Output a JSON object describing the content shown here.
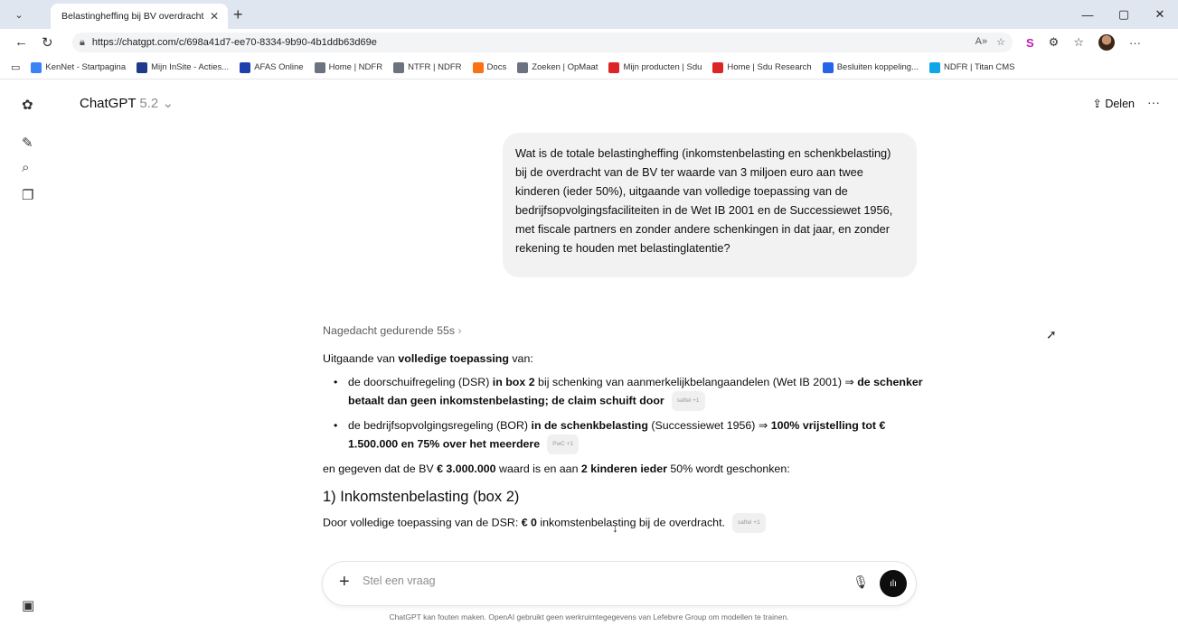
{
  "browser": {
    "tab_title": "Belastingheffing bij BV overdracht",
    "url": "https://chatgpt.com/c/698a41d7-ee70-8334-9b90-4b1ddb63d69e",
    "bookmarks": [
      {
        "label": "KenNet - Startpagina",
        "color": "#3b82f6"
      },
      {
        "label": "Mijn InSite - Acties...",
        "color": "#1e3a8a"
      },
      {
        "label": "AFAS Online",
        "color": "#1e40af"
      },
      {
        "label": "Home | NDFR",
        "color": "#6b7280"
      },
      {
        "label": "NTFR | NDFR",
        "color": "#6b7280"
      },
      {
        "label": "Docs",
        "color": "#f97316"
      },
      {
        "label": "Zoeken | OpMaat",
        "color": "#6b7280"
      },
      {
        "label": "Mijn producten | Sdu",
        "color": "#dc2626"
      },
      {
        "label": "Home | Sdu Research",
        "color": "#dc2626"
      },
      {
        "label": "Besluiten koppeling...",
        "color": "#2563eb"
      },
      {
        "label": "NDFR | Titan CMS",
        "color": "#0ea5e9"
      }
    ]
  },
  "app": {
    "model_name": "ChatGPT",
    "model_version": "5.2",
    "share_label": "Delen"
  },
  "conversation": {
    "user_message": "Wat is de totale belastingheffing (inkomstenbelasting en schenkbelasting) bij de overdracht van de BV ter waarde van 3 miljoen euro aan twee kinderen (ieder 50%), uitgaande van volledige toepassing van de bedrijfsopvolgingsfaciliteiten in de Wet IB 2001 en de Successiewet 1956, met fiscale partners en zonder andere schenkingen in dat jaar, en zonder rekening te houden met belastinglatentie?",
    "thought_label": "Nagedacht gedurende 55s",
    "intro_prefix": "Uitgaande van ",
    "intro_bold": "volledige toepassing",
    "intro_suffix": " van:",
    "bullet1": {
      "t1": "de doorschuifregeling (DSR) ",
      "b1": "in box 2",
      "t2": " bij schenking van aanmerkelijkbelangaandelen (Wet IB 2001) ⇒ ",
      "b2": "de schenker betaalt dan geen inkomstenbelasting; de claim schuift door",
      "badge": "saftel +1"
    },
    "bullet2": {
      "t1": "de bedrijfsopvolgingsregeling (BOR) ",
      "b1": "in de schenkbelasting",
      "t2": " (Successiewet 1956) ⇒ ",
      "b2": "100% vrijstelling tot € 1.500.000 en 75% over het meerdere",
      "badge": "PwC +1"
    },
    "given_t1": "en gegeven dat de BV ",
    "given_b1": "€ 3.000.000",
    "given_t2": " waard is en aan ",
    "given_b2": "2 kinderen ieder",
    "given_t3": " 50% wordt geschonken:",
    "section_heading": "1) Inkomstenbelasting (box 2)",
    "dsr_t1": "Door volledige toepassing van de DSR: ",
    "dsr_b1": "€ 0",
    "dsr_t2": " inkomstenbelasting bij de overdracht.",
    "dsr_badge": "saftel +1"
  },
  "composer": {
    "placeholder": "Stel een vraag"
  },
  "footer": {
    "disclaimer": "ChatGPT kan fouten maken. OpenAI gebruikt geen werkruimtegegevens van Lefebvre Group om modellen te trainen."
  },
  "icons": {
    "tab_menu": "chevron-down-icon",
    "new_tab": "plus-icon",
    "back": "back-arrow-icon",
    "refresh": "refresh-icon",
    "lock": "lock-icon",
    "rail": [
      "openai-logo-icon",
      "new-chat-icon",
      "search-icon",
      "library-icon",
      "profile-icon"
    ]
  }
}
